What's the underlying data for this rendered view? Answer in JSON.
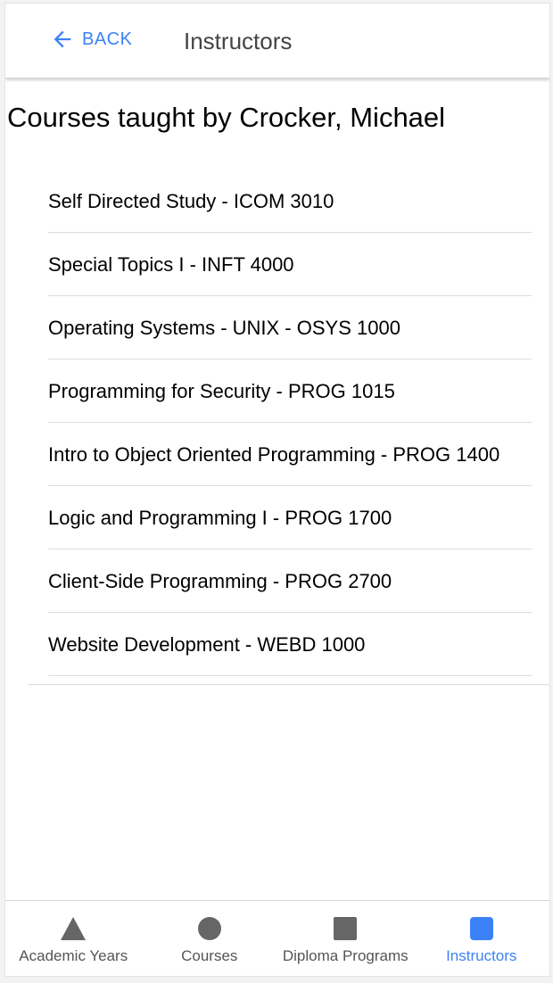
{
  "header": {
    "back_label": "BACK",
    "title": "Instructors"
  },
  "page": {
    "heading": "Courses taught by Crocker, Michael"
  },
  "courses": [
    "Self Directed Study - ICOM 3010",
    "Special Topics I - INFT 4000",
    "Operating Systems - UNIX - OSYS 1000",
    "Programming for Security - PROG 1015",
    "Intro to Object Oriented Programming - PROG 1400",
    "Logic and Programming I - PROG 1700",
    "Client-Side Programming - PROG 2700",
    "Website Development - WEBD 1000"
  ],
  "tabs": [
    {
      "label": "Academic Years",
      "icon": "triangle-icon",
      "active": false
    },
    {
      "label": "Courses",
      "icon": "circle-icon",
      "active": false
    },
    {
      "label": "Diploma Programs",
      "icon": "square-icon",
      "active": false
    },
    {
      "label": "Instructors",
      "icon": "rounded-square-icon",
      "active": true
    }
  ],
  "colors": {
    "accent": "#3b82f6",
    "icon_inactive": "#666666"
  }
}
